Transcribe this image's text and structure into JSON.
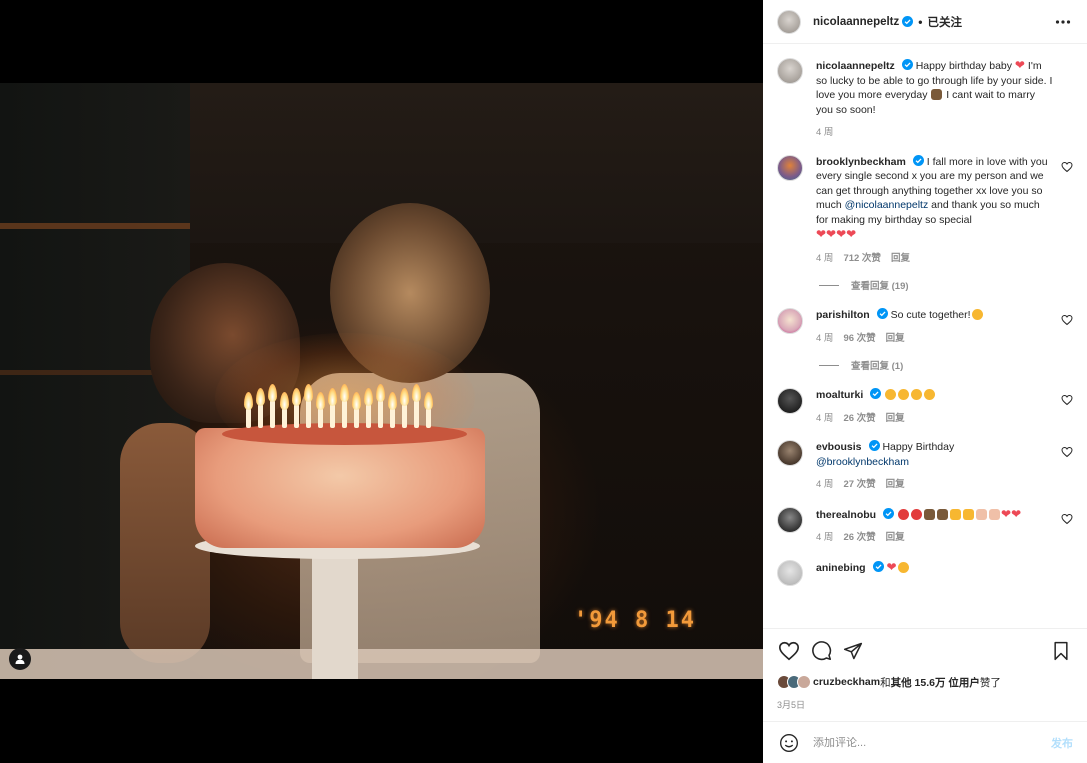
{
  "header": {
    "username": "nicolaannepeltz",
    "follow_state": "已关注"
  },
  "photo": {
    "datestamp": "'94  8  14"
  },
  "caption": {
    "username": "nicolaannepeltz",
    "text_1": "Happy birthday baby ",
    "text_2": " I'm so lucky to be able to go through life by your side. I love you more everyday ",
    "text_3": " I cant wait to marry you so soon!",
    "time": "4 周"
  },
  "comments": [
    {
      "username": "brooklynbeckham",
      "text_1": "I fall more in love with you every single second x you are my person and we can get through anything together xx love you so much ",
      "mention": "@nicolaannepeltz",
      "text_2": " and thank you so much for making my birthday so special",
      "hearts": "❤❤❤❤",
      "time": "4 周",
      "likes": "712 次赞",
      "reply": "回复",
      "view_replies": "查看回复 (19)"
    },
    {
      "username": "parishilton",
      "text": "So cute together!",
      "time": "4 周",
      "likes": "96 次赞",
      "reply": "回复",
      "view_replies": "查看回复 (1)"
    },
    {
      "username": "moalturki",
      "time": "4 周",
      "likes": "26 次赞",
      "reply": "回复"
    },
    {
      "username": "evbousis",
      "text": "Happy Birthday",
      "mention": "@brooklynbeckham",
      "time": "4 周",
      "likes": "27 次赞",
      "reply": "回复"
    },
    {
      "username": "therealnobu",
      "time": "4 周",
      "likes": "26 次赞",
      "reply": "回复"
    },
    {
      "username": "aninebing"
    }
  ],
  "likes_row": {
    "first_user": "cruzbeckham",
    "and": " 和 ",
    "others": "其他 15.6万 位用户",
    "suffix": " 赞了"
  },
  "post_date": "3月5日",
  "add_comment": {
    "placeholder": "添加评论...",
    "post_label": "发布"
  },
  "colors": {
    "verified": "#0095f6",
    "heart": "#ed4956",
    "post_button": "#b2dffc",
    "datestamp": "#f29a3a"
  },
  "icons": [
    "verified-badge-icon",
    "more-icon",
    "heart-icon",
    "comment-icon",
    "share-icon",
    "bookmark-icon",
    "emoji-icon",
    "user-tag-icon"
  ]
}
